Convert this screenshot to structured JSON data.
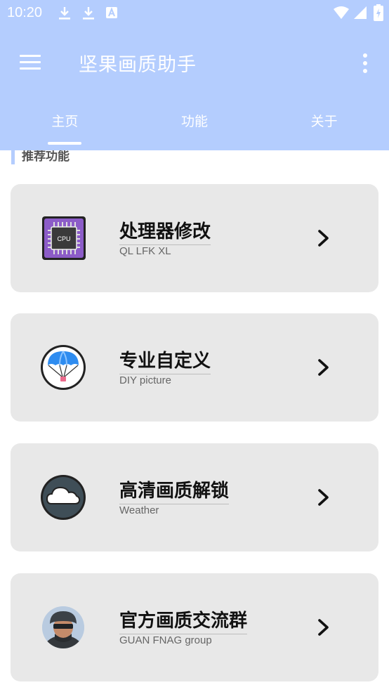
{
  "status_bar": {
    "time": "10:20",
    "left_icons": [
      "download-icon",
      "download-icon",
      "a-badge-icon"
    ],
    "right_icons": [
      "wifi-icon",
      "signal-icon",
      "battery-icon"
    ]
  },
  "toolbar": {
    "title": "坚果画质助手",
    "menu_icon": "hamburger-menu-icon",
    "more_icon": "more-vert-icon"
  },
  "tabs": [
    {
      "label": "主页",
      "selected": true
    },
    {
      "label": "功能",
      "selected": false
    },
    {
      "label": "关于",
      "selected": false
    }
  ],
  "section": {
    "label": "推荐功能"
  },
  "cards": [
    {
      "title": "处理器修改",
      "subtitle": "QL LFK XL",
      "icon": "cpu-icon",
      "icon_text": "CPU"
    },
    {
      "title": "专业自定义",
      "subtitle": "DIY picture",
      "icon": "parachute-icon"
    },
    {
      "title": "高清画质解锁",
      "subtitle": "Weather",
      "icon": "cloud-icon"
    },
    {
      "title": "官方画质交流群",
      "subtitle": "GUAN FNAG group",
      "icon": "avatar-icon"
    }
  ],
  "colors": {
    "app_bar": "#b4cdfe",
    "card_bg": "#e8e8e8",
    "cpu_purple": "#8c5cc8",
    "parachute_blue": "#2e8cf0",
    "cloud_dark": "#3f4e57"
  }
}
